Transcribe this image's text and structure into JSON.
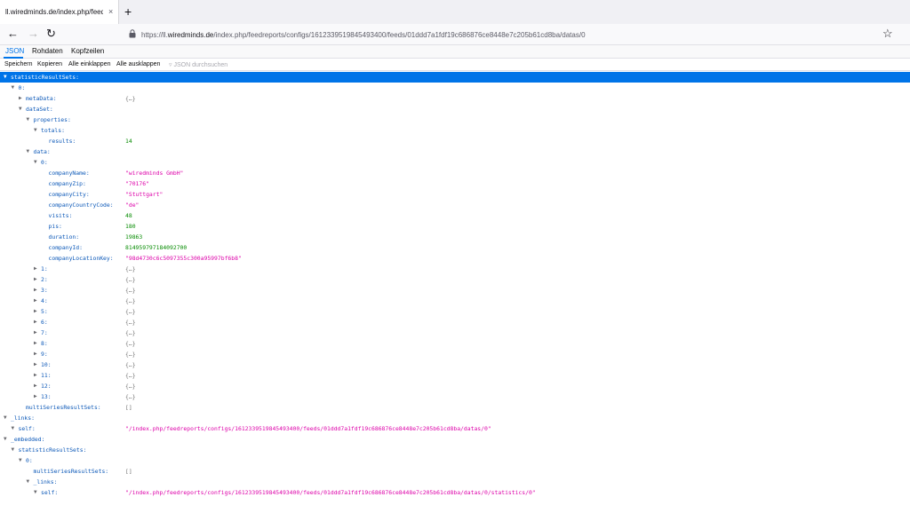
{
  "browser": {
    "tab_title": "ll.wiredminds.de/index.php/feedrep",
    "tab_close": "×",
    "new_tab": "+",
    "url_prefix": "https://ll.",
    "url_domain": "wiredminds.de",
    "url_path": "/index.php/feedreports/configs/1612339519845493400/feeds/01ddd7a1fdf19c686876ce8448e7c205b61cd8ba/datas/0",
    "back": "←",
    "forward": "→",
    "reload": "↻",
    "bookmark": "☆"
  },
  "viewer": {
    "tabs": [
      "JSON",
      "Rohdaten",
      "Kopfzeilen"
    ],
    "toolbar": [
      "Speichern",
      "Kopieren",
      "Alle einklappen",
      "Alle ausklappen"
    ],
    "filter_placeholder": "JSON durchsuchen",
    "filter_icon": "funnel-icon"
  },
  "rows": [
    {
      "key": "statisticResultSets:",
      "val": ""
    },
    {
      "key": "0:",
      "val": ""
    },
    {
      "key": "metaData:",
      "val": "{…}"
    },
    {
      "key": "dataSet:",
      "val": ""
    },
    {
      "key": "properties:",
      "val": ""
    },
    {
      "key": "totals:",
      "val": ""
    },
    {
      "key": "results:",
      "val": "14"
    },
    {
      "key": "data:",
      "val": ""
    },
    {
      "key": "0:",
      "val": ""
    },
    {
      "key": "companyName:",
      "val": "\"wiredminds GmbH\""
    },
    {
      "key": "companyZip:",
      "val": "\"70176\""
    },
    {
      "key": "companyCity:",
      "val": "\"Stuttgart\""
    },
    {
      "key": "companyCountryCode:",
      "val": "\"de\""
    },
    {
      "key": "visits:",
      "val": "48"
    },
    {
      "key": "pis:",
      "val": "180"
    },
    {
      "key": "duration:",
      "val": "19863"
    },
    {
      "key": "companyId:",
      "val": "814959797184092700"
    },
    {
      "key": "companyLocationKey:",
      "val": "\"98d4730c6c5097355c300a95997bf6b8\""
    },
    {
      "key": "1:",
      "val": "{…}"
    },
    {
      "key": "2:",
      "val": "{…}"
    },
    {
      "key": "3:",
      "val": "{…}"
    },
    {
      "key": "4:",
      "val": "{…}"
    },
    {
      "key": "5:",
      "val": "{…}"
    },
    {
      "key": "6:",
      "val": "{…}"
    },
    {
      "key": "7:",
      "val": "{…}"
    },
    {
      "key": "8:",
      "val": "{…}"
    },
    {
      "key": "9:",
      "val": "{…}"
    },
    {
      "key": "10:",
      "val": "{…}"
    },
    {
      "key": "11:",
      "val": "{…}"
    },
    {
      "key": "12:",
      "val": "{…}"
    },
    {
      "key": "13:",
      "val": "{…}"
    },
    {
      "key": "multiSeriesResultSets:",
      "val": "[]"
    },
    {
      "key": "_links:",
      "val": ""
    },
    {
      "key": "self:",
      "val": "\"/index.php/feedreports/configs/1612339519845493400/feeds/01ddd7a1fdf19c686876ce8448e7c205b61cd8ba/datas/0\""
    },
    {
      "key": "_embedded:",
      "val": ""
    },
    {
      "key": "statisticResultSets:",
      "val": ""
    },
    {
      "key": "0:",
      "val": ""
    },
    {
      "key": "multiSeriesResultSets:",
      "val": "[]"
    },
    {
      "key": "_links:",
      "val": ""
    },
    {
      "key": "self:",
      "val": "\"/index.php/feedreports/configs/1612339519845493400/feeds/01ddd7a1fdf19c686876ce8448e7c205b61cd8ba/datas/0/statistics/0\""
    }
  ]
}
